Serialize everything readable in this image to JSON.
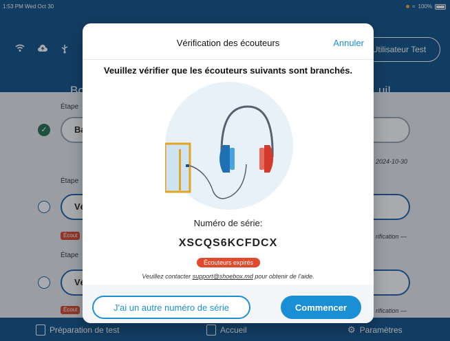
{
  "status_bar": {
    "time": "1:53 PM  Wed Oct 30",
    "battery": "100%"
  },
  "header": {
    "user_button": "Utilisateur Test",
    "hero_left": "Bo",
    "hero_right": "ui!"
  },
  "steps": [
    {
      "label": "Étape",
      "pill": "Ba",
      "meta": "2024-10-30",
      "state": "done"
    },
    {
      "label": "Étape",
      "pill": "Vé",
      "meta": "rification —",
      "badge": "Écout",
      "state": "todo"
    },
    {
      "label": "Étape",
      "pill": "Vé",
      "meta": "rification —",
      "badge": "Écout",
      "state": "todo"
    }
  ],
  "bottom_nav": {
    "left": "Préparation de test",
    "center": "Accueil",
    "right": "Paramètres"
  },
  "modal": {
    "title": "Vérification des écouteurs",
    "cancel": "Annuler",
    "instruction": "Veuillez vérifier que les écouteurs suivants sont branchés.",
    "serial_label": "Numéro de série:",
    "serial_value": "XSCQS6KCFDCX",
    "expired_badge": "Écouteurs expirés",
    "contact_prefix": "Veuillez contacter ",
    "contact_email": "support@shoebox.md",
    "contact_suffix": " pour obtenir de l'aide.",
    "btn_other": "J'ai un autre numéro de série",
    "btn_start": "Commencer"
  },
  "colors": {
    "brand_blue": "#0d4f86",
    "accent_blue": "#1a8fd6",
    "expired_red": "#e04a2f",
    "earcup_left": "#1f6fb5",
    "earcup_right": "#d23a2c"
  }
}
